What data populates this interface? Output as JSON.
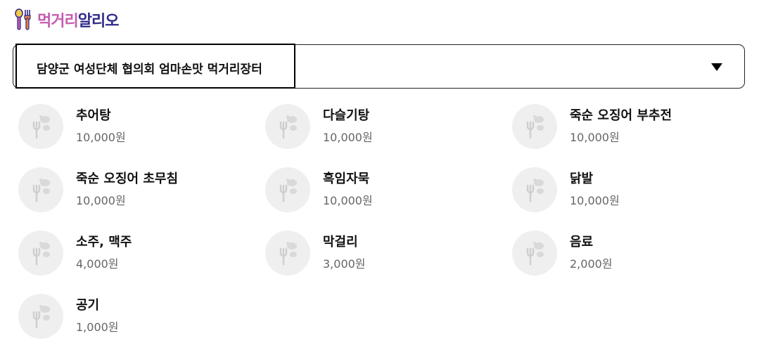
{
  "brand": {
    "logo_part1": "먹거리",
    "logo_part2": "알리오",
    "logo_icon": "utensils-icon"
  },
  "store_select": {
    "selected": "담양군 여성단체 협의회 엄마손맛 먹거리장터",
    "arrow_icon": "caret-down-icon"
  },
  "menu_items": [
    {
      "name": "추어탕",
      "price": "10,000원"
    },
    {
      "name": "다슬기탕",
      "price": "10,000원"
    },
    {
      "name": "죽순 오징어 부추전",
      "price": "10,000원"
    },
    {
      "name": "죽순 오징어 초무침",
      "price": "10,000원"
    },
    {
      "name": "흑임자묵",
      "price": "10,000원"
    },
    {
      "name": "닭발",
      "price": "10,000원"
    },
    {
      "name": "소주, 맥주",
      "price": "4,000원"
    },
    {
      "name": "막걸리",
      "price": "3,000원"
    },
    {
      "name": "음료",
      "price": "2,000원"
    },
    {
      "name": "공기",
      "price": "1,000원"
    }
  ],
  "colors": {
    "logo_pink": "#c45bb0",
    "logo_navy": "#2f2a8a",
    "placeholder_bg": "#efefef",
    "price_text": "#666666"
  }
}
